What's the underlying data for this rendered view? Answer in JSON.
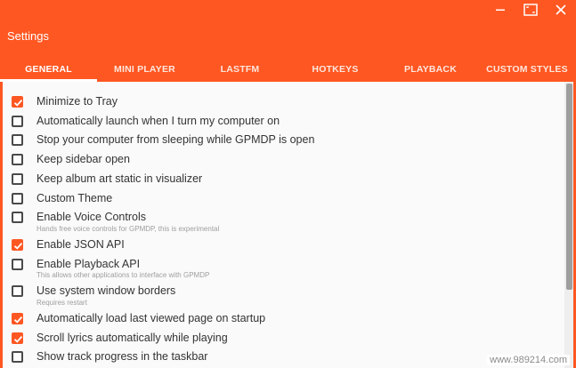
{
  "window": {
    "title": "Settings"
  },
  "tabs": [
    {
      "label": "GENERAL",
      "active": true
    },
    {
      "label": "MINI PLAYER",
      "active": false
    },
    {
      "label": "LASTFM",
      "active": false
    },
    {
      "label": "HOTKEYS",
      "active": false
    },
    {
      "label": "PLAYBACK",
      "active": false
    },
    {
      "label": "CUSTOM STYLES",
      "active": false
    }
  ],
  "options": [
    {
      "label": "Minimize to Tray",
      "checked": true
    },
    {
      "label": "Automatically launch when I turn my computer on",
      "checked": false
    },
    {
      "label": "Stop your computer from sleeping while GPMDP is open",
      "checked": false
    },
    {
      "label": "Keep sidebar open",
      "checked": false
    },
    {
      "label": "Keep album art static in visualizer",
      "checked": false
    },
    {
      "label": "Custom Theme",
      "checked": false
    },
    {
      "label": "Enable Voice Controls",
      "sub": "Hands free voice controls for GPMDP, this is experimental",
      "checked": false
    },
    {
      "label": "Enable JSON API",
      "checked": true
    },
    {
      "label": "Enable Playback API",
      "sub": "This allows other applications to interface with GPMDP",
      "checked": false
    },
    {
      "label": "Use system window borders",
      "sub": "Requires restart",
      "checked": false
    },
    {
      "label": "Automatically load last viewed page on startup",
      "checked": true
    },
    {
      "label": "Scroll lyrics automatically while playing",
      "checked": true
    },
    {
      "label": "Show track progress in the taskbar",
      "checked": false
    }
  ],
  "watermark": "www.989214.com",
  "colors": {
    "accent": "#ff5722",
    "content_bg": "#fafafa"
  }
}
